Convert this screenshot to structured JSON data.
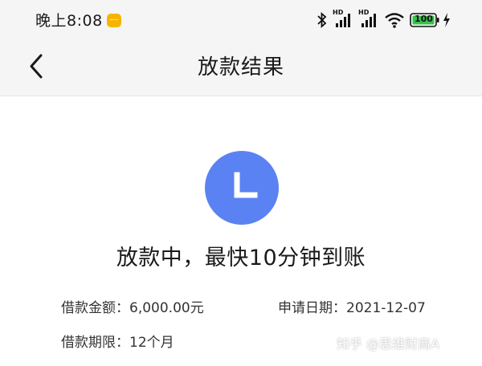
{
  "status_bar": {
    "time": "晚上8:08",
    "signal_1_label": "HD",
    "signal_2_label": "HD",
    "battery_level": "100",
    "icons": [
      "notification-app-icon",
      "bluetooth-icon",
      "signal-icon",
      "signal-icon",
      "wifi-icon",
      "battery-icon",
      "charging-icon"
    ]
  },
  "nav": {
    "title": "放款结果",
    "back_icon": "chevron-left-icon"
  },
  "result": {
    "icon": "clock-icon",
    "icon_color": "#5b82f3",
    "status_text": "放款中，最快10分钟到账"
  },
  "details": {
    "amount_label": "借款金额：",
    "amount_value": "6,000.00元",
    "date_label": "申请日期：",
    "date_value": "2021-12-07",
    "term_label": "借款期限：",
    "term_value": "12个月"
  },
  "watermark": "知乎 @思维财商A"
}
